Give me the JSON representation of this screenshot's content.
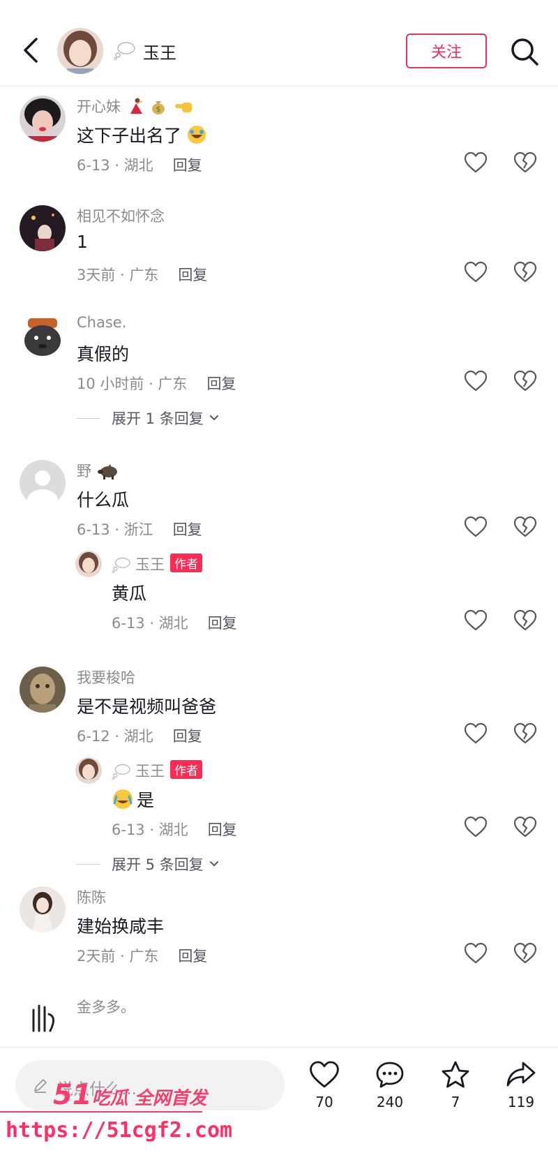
{
  "header": {
    "name": "玉王",
    "follow_label": "关注"
  },
  "icons": {
    "back": "chevron-left-icon",
    "search": "search-icon",
    "like": "heart-outline-icon",
    "dislike": "broken-heart-icon",
    "comment": "comment-bubble-icon",
    "favorite": "star-icon",
    "share": "share-arrow-icon",
    "edit": "pen-icon"
  },
  "colors": {
    "accent": "#fe2c55",
    "follow": "#e2335a",
    "meta": "#8a8b91"
  },
  "comments": [
    {
      "username": "开心妹",
      "text": "这下子出名了",
      "date_location": "6-13 · 湖北",
      "reply_label": "回复"
    },
    {
      "username": "相见不如怀念",
      "text": "1",
      "date_location": "3天前 · 广东",
      "reply_label": "回复"
    },
    {
      "username": "Chase.",
      "text": "真假的",
      "date_location": "10 小时前 · 广东",
      "reply_label": "回复",
      "expand_label": "展开 1 条回复"
    },
    {
      "username": "野",
      "text": "什么瓜",
      "date_location": "6-13 · 浙江",
      "reply_label": "回复",
      "reply": {
        "username": "玉王",
        "badge": "作者",
        "text": "黄瓜",
        "date_location": "6-13 · 湖北",
        "reply_label": "回复"
      }
    },
    {
      "username": "我要梭哈",
      "text": "是不是视频叫爸爸",
      "date_location": "6-12 · 湖北",
      "reply_label": "回复",
      "reply": {
        "username": "玉王",
        "badge": "作者",
        "text": "是",
        "date_location": "6-13 · 湖北",
        "reply_label": "回复"
      },
      "expand_label": "展开 5 条回复"
    },
    {
      "username": "陈陈",
      "text": "建始换咸丰",
      "date_location": "2天前 · 广东",
      "reply_label": "回复"
    },
    {
      "username": "金多多。"
    }
  ],
  "bottom_bar": {
    "input_placeholder": "说点什么...",
    "like_count": "70",
    "comment_count": "240",
    "favorite_count": "7",
    "share_count": "119"
  },
  "watermark": {
    "line1_big": "51",
    "line1_rest": "吃瓜 全网首发",
    "line2": "https://51cgf2.com"
  }
}
